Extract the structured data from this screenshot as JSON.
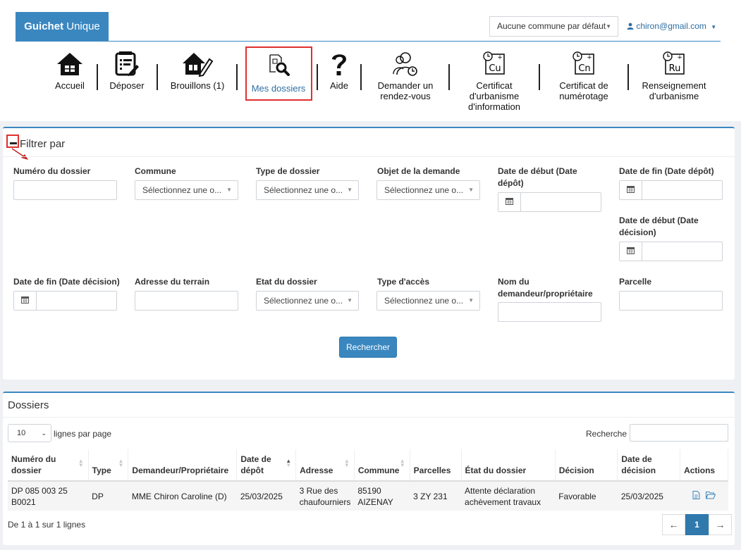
{
  "brand": {
    "bold": "Guichet",
    "rest": " Unique"
  },
  "header": {
    "commune_select": "Aucune commune par défaut",
    "user_email": "chiron@gmail.com"
  },
  "nav": {
    "items": [
      {
        "label": "Accueil",
        "icon": "home-icon"
      },
      {
        "label": "Déposer",
        "icon": "document-edit-icon"
      },
      {
        "label": "Brouillons (1)",
        "icon": "house-pencil-icon"
      },
      {
        "label": "Mes dossiers",
        "icon": "folder-search-icon",
        "active": true
      },
      {
        "label": "Aide",
        "icon": "question-icon"
      },
      {
        "label": "Demander un rendez-vous",
        "icon": "users-clock-icon"
      },
      {
        "label": "Certificat d'urbanisme d'information",
        "icon": "cu-clock-icon",
        "code": "Cu"
      },
      {
        "label": "Certificat de numérotage",
        "icon": "cn-clock-icon",
        "code": "Cn"
      },
      {
        "label": "Renseignement d'urbanisme",
        "icon": "ru-clock-icon",
        "code": "Ru"
      }
    ]
  },
  "filter": {
    "title": "Filtrer par",
    "labels": {
      "numero": "Numéro du dossier",
      "commune": "Commune",
      "type": "Type de dossier",
      "objet": "Objet de la demande",
      "debut_depot": "Date de début (Date dépôt)",
      "fin_depot": "Date de fin (Date dépôt)",
      "debut_decision": "Date de début (Date décision)",
      "fin_decision": "Date de fin (Date décision)",
      "adresse": "Adresse du terrain",
      "etat": "Etat du dossier",
      "acces": "Type d'accès",
      "nom": "Nom du demandeur/propriétaire",
      "parcelle": "Parcelle"
    },
    "select_placeholder": "Sélectionnez une o...",
    "search_button": "Rechercher"
  },
  "dossiers": {
    "title": "Dossiers",
    "page_size": "10",
    "page_size_label": "lignes par page",
    "search_label": "Recherche",
    "columns": [
      "Numéro du dossier",
      "Type",
      "Demandeur/Propriétaire",
      "Date de dépôt",
      "Adresse",
      "Commune",
      "Parcelles",
      "État du dossier",
      "Décision",
      "Date de décision",
      "Actions"
    ],
    "rows": [
      {
        "numero": "DP 085 003 25 B0021",
        "type": "DP",
        "demandeur": "MME Chiron Caroline (D)",
        "date_depot": "25/03/2025",
        "adresse": "3 Rue des chaufourniers",
        "commune": "85190 AIZENAY",
        "parcelles": "3 ZY 231",
        "etat": "Attente déclaration achèvement travaux",
        "decision": "Favorable",
        "date_decision": "25/03/2025"
      }
    ],
    "info": "De 1 à 1 sur 1 lignes",
    "pager": {
      "prev": "←",
      "current": "1",
      "next": "→"
    }
  }
}
